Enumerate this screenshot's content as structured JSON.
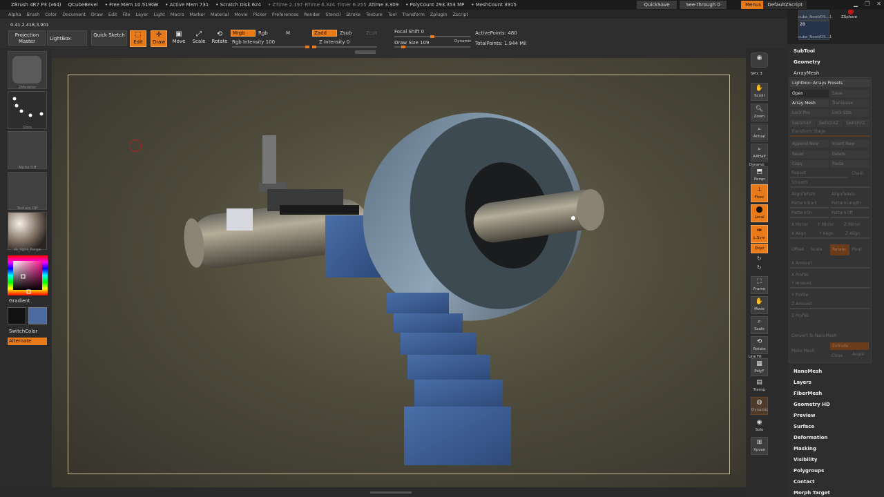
{
  "title_bar": {
    "app": "ZBrush 4R7 P3 (x64)",
    "doc": "QCubeBevel",
    "free_mem": "• Free Mem 10.519GB",
    "active_mem": "• Active Mem 731",
    "scratch": "• Scratch Disk 624",
    "ztime": "• ZTime 2.197",
    "rtime": "RTime 6.324",
    "timer": "Timer 6.255",
    "atime": "ATime 3.309",
    "polycount": "• PolyCount 293.353 MP",
    "meshcount": "• MeshCount 3915",
    "quicksave": "QuickSave",
    "see_through": "See-through 0",
    "menus": "Menus",
    "default_zscript": "DefaultZScript"
  },
  "menu": [
    "Alpha",
    "Brush",
    "Color",
    "Document",
    "Draw",
    "Edit",
    "File",
    "Layer",
    "Light",
    "Macro",
    "Marker",
    "Material",
    "Movie",
    "Picker",
    "Preferences",
    "Render",
    "Stencil",
    "Stroke",
    "Texture",
    "Tool",
    "Transform",
    "Zplugin",
    "Zscript"
  ],
  "thumbs": {
    "top_label": "cube_NewVDS...1",
    "count": "28",
    "bottom_label": "cube_NewVDS...1",
    "zsphere": "ZSphere"
  },
  "toolbar": {
    "coords": "0.41,2.418,3.901",
    "projection_master": "Projection Master",
    "lightbox": "LightBox",
    "quick_sketch": "Quick Sketch",
    "edit": "Edit",
    "draw": "Draw",
    "move": "Move",
    "scale": "Scale",
    "rotate": "Rotate",
    "mrgb": "Mrgb",
    "rgb": "Rgb",
    "m": "M",
    "rgb_intensity": "Rgb Intensity 100",
    "zadd": "Zadd",
    "zsub": "Zsub",
    "zcut": "Zcut",
    "z_intensity": "Z Intensity 0",
    "focal_shift": "Focal Shift 0",
    "draw_size": "Draw Size 109",
    "dynamic": "Dynamic",
    "active_points": "ActivePoints: 480",
    "total_points": "TotalPoints: 1.944 Mil",
    "rgb_intensity_level": 1.0,
    "z_intensity_level": 0.0,
    "focal_shift_level": 0.5,
    "draw_size_level": 0.1
  },
  "left_shelf": {
    "brush_caption": "ZModeler",
    "stroke_caption": "Dots",
    "alpha_caption": "Alpha Off",
    "texture_caption": "Texture Off",
    "material_caption": "zk_light_Forge",
    "gradient": "Gradient",
    "switch_color": "SwitchColor",
    "alternate": "Alternate"
  },
  "right_shelf": {
    "bpr": "BPR",
    "spix": "SPix 3",
    "scroll": "Scroll",
    "zoom": "Zoom",
    "actual": "Actual",
    "aahalf": "AAHalf",
    "dynamic": "Dynamic",
    "persp": "Persp",
    "floor": "Floor",
    "local": "Local",
    "lsym": "L.Sym",
    "xyz": "Qxyz",
    "frame": "Frame",
    "move": "Move",
    "scale": "Scale",
    "rotate": "Rotate",
    "linefill": "Line Fill",
    "polyf": "PolyF",
    "transp": "Transp",
    "ghost": "Dynamic",
    "solo": "Solo",
    "xpose": "Xpose"
  },
  "tray": {
    "subtool": "SubTool",
    "geometry": "Geometry",
    "arraymesh": "ArrayMesh",
    "presets": "Lightbox› Arrays Presets",
    "open": "Open",
    "save": "Save",
    "array_mesh": "Array Mesh",
    "transpose": "Transpose",
    "lock_pos": "Lock Pos",
    "lock_size": "Lock Size",
    "switchxy": "SwitchXY",
    "switchxz": "SwitchXZ",
    "switchyz": "SwitchYZ",
    "transform_stage": "Transform Stage",
    "append_new": "Append New",
    "insert_new": "Insert New",
    "reset": "Reset",
    "delete": "Delete",
    "copy": "Copy",
    "paste": "Paste",
    "repeat": "Repeat",
    "chain": "Chain",
    "smooth": "Smooth",
    "align_to_path": "AlignToPath",
    "align_to_axis": "AlignToAxis",
    "pattern_start": "PatternStart",
    "pattern_length": "PatternLength",
    "pattern_on": "PatternOn",
    "pattern_off": "PatternOff",
    "x_mirror": "X Mirror",
    "y_mirror": "Y Mirror",
    "z_mirror": "Z Mirror",
    "x_align": "X Align",
    "y_align": "Y Align",
    "z_align": "Z Align",
    "offset": "Offset",
    "scale": "Scale",
    "rotate": "Rotate",
    "pivot": "Pivot",
    "x_amount": "X Amount",
    "x_profile": "X Profile",
    "y_amount": "Y Amount",
    "y_profile": "Y Profile",
    "z_amount": "Z Amount",
    "z_profile": "Z Profile",
    "convert": "Convert To NanoMesh",
    "make_mesh": "Make Mesh",
    "extrude": "Extrude",
    "close": "Close",
    "angle": "Angle",
    "items": [
      "NanoMesh",
      "Layers",
      "FiberMesh",
      "Geometry HD",
      "Preview",
      "Surface",
      "Deformation",
      "Masking",
      "Visibility",
      "Polygroups",
      "Contact",
      "Morph Target"
    ]
  },
  "colors": {
    "accent": "#e87a1a",
    "primary_color": "#111111",
    "secondary_color": "#4a6aa0"
  }
}
